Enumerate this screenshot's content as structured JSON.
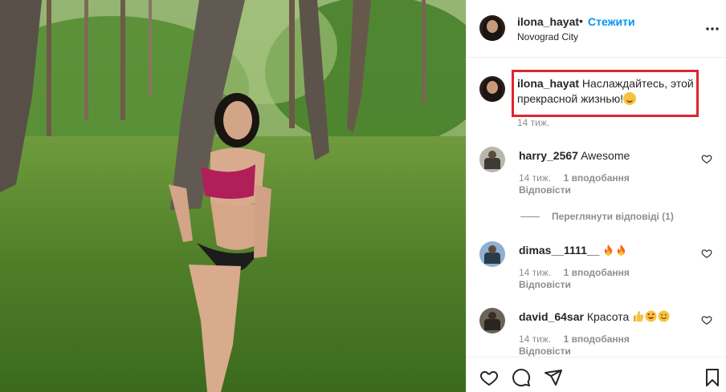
{
  "header": {
    "username": "ilona_hayat",
    "separator": "•",
    "follow_label": "Стежити",
    "location": "Novograd City",
    "more_icon": "more-horizontal-icon"
  },
  "caption": {
    "username": "ilona_hayat",
    "text": "Наслаждайтесь, этой прекрасной жизнью!",
    "emoji": "smiling-face-icon",
    "time": "14 тиж.",
    "highlight_color": "#e0242e"
  },
  "comments": [
    {
      "username": "harry_2567",
      "text": "Awesome",
      "time": "14 тиж.",
      "likes": "1 вподобання",
      "reply_label": "Відповісти"
    },
    {
      "username": "dimas__1111__",
      "text": "",
      "emojis": [
        "fire-icon",
        "fire-icon"
      ],
      "time": "14 тиж.",
      "likes": "1 вподобання",
      "reply_label": "Відповісти"
    },
    {
      "username": "david_64sar",
      "text": "Красота",
      "emojis": [
        "thumbs-up-icon",
        "heart-eyes-icon",
        "smile-icon"
      ],
      "time": "14 тиж.",
      "likes": "1 вподобання",
      "reply_label": "Відповісти"
    }
  ],
  "view_replies_label": "Переглянути відповіді (1)",
  "actions": {
    "like_icon": "heart-icon",
    "comment_icon": "comment-icon",
    "share_icon": "share-icon",
    "save_icon": "bookmark-icon"
  },
  "colors": {
    "link_blue": "#0095f6",
    "muted": "#8e8e8e",
    "text": "#262626",
    "border": "#efefef"
  }
}
